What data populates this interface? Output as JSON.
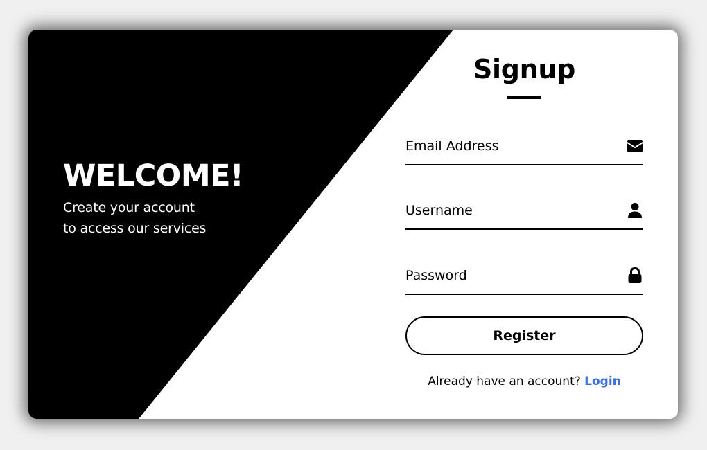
{
  "welcome": {
    "title": "WELCOME!",
    "subtitle_line1": "Create your account",
    "subtitle_line2": "to access our services"
  },
  "form": {
    "title": "Signup",
    "email": {
      "placeholder": "Email Address",
      "value": "",
      "icon": "envelope-icon"
    },
    "username": {
      "placeholder": "Username",
      "value": "",
      "icon": "user-icon"
    },
    "password": {
      "placeholder": "Password",
      "value": "",
      "icon": "lock-icon"
    },
    "register_label": "Register",
    "login_prompt": "Already have an account?",
    "login_label": "Login"
  },
  "colors": {
    "background": "#f0f0f0",
    "card": "#ffffff",
    "panel": "#000000",
    "accent_link": "#3f6fd8"
  }
}
